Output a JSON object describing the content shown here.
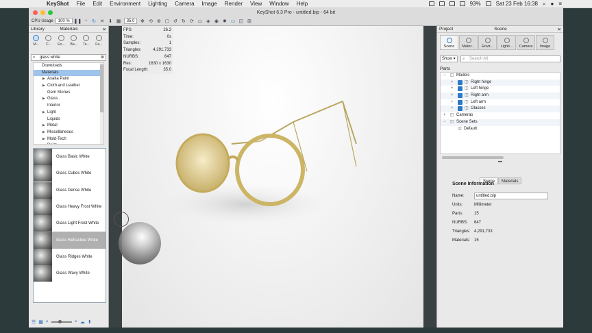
{
  "menubar": {
    "app": "KeyShot",
    "items": [
      "File",
      "Edit",
      "Environment",
      "Lighting",
      "Camera",
      "Image",
      "Render",
      "View",
      "Window",
      "Help"
    ],
    "battery": "93%",
    "clock": "Sat 23 Feb  16:38"
  },
  "window": {
    "title": "KeyShot 6.3 Pro  - untitled.bip  - 64 bit"
  },
  "toolbar": {
    "cpu_label": "CPU Usage",
    "cpu_value": "100 %",
    "focal_value": "35.0"
  },
  "library": {
    "header": "Library",
    "title": "Materials",
    "categories": [
      "M...",
      "C...",
      "En...",
      "Ba...",
      "Te...",
      "Fa..."
    ],
    "search_value": "glass white",
    "tree": [
      {
        "label": "Downloads",
        "level": 0,
        "style": "down"
      },
      {
        "label": "Materials",
        "level": 0,
        "style": "sel"
      },
      {
        "label": "Axalta Paint",
        "level": 1,
        "arrow": true
      },
      {
        "label": "Cloth and Leather",
        "level": 1,
        "arrow": true
      },
      {
        "label": "Gem Stones",
        "level": 1,
        "arrow": false
      },
      {
        "label": "Glass",
        "level": 1,
        "arrow": true
      },
      {
        "label": "Interior",
        "level": 1,
        "arrow": false
      },
      {
        "label": "Light",
        "level": 1,
        "arrow": true
      },
      {
        "label": "Liquids",
        "level": 1,
        "arrow": false
      },
      {
        "label": "Metal",
        "level": 1,
        "arrow": true
      },
      {
        "label": "Miscellaneous",
        "level": 1,
        "arrow": true
      },
      {
        "label": "Mold-Tech",
        "level": 1,
        "arrow": true
      },
      {
        "label": "Paint",
        "level": 1,
        "arrow": true
      }
    ],
    "thumbnails": [
      "Glass Basic White",
      "Glass Cubes White",
      "Glass Dense White",
      "Glass Heavy Frost White",
      "Glass Light Frost White",
      "Glass Refractive White",
      "Glass Ridges White",
      "Glass Wavy White"
    ],
    "selected_thumbnail": "Glass Refractive White"
  },
  "stats": [
    {
      "k": "FPS:",
      "v": "26.3"
    },
    {
      "k": "Time:",
      "v": "0s"
    },
    {
      "k": "Samples:",
      "v": "1"
    },
    {
      "k": "Triangles:",
      "v": "4,291,733"
    },
    {
      "k": "NURBS:",
      "v": "647"
    },
    {
      "k": "Res:",
      "v": "1630 x 1630"
    },
    {
      "k": "Focal Length:",
      "v": "35.0"
    }
  ],
  "project": {
    "header": "Project",
    "title": "Scene",
    "tabs": [
      "Scene",
      "Mater...",
      "Envir...",
      "Lighti...",
      "Camera",
      "Image"
    ],
    "show_label": "Show",
    "search_placeholder": "Search All",
    "parts_label": "Parts",
    "tree": [
      {
        "label": "Models",
        "level": 0,
        "pm": "-"
      },
      {
        "label": "Right hinge",
        "level": 1,
        "pm": "+",
        "checked": true
      },
      {
        "label": "Left hinge",
        "level": 1,
        "pm": "+",
        "checked": true
      },
      {
        "label": "Right arm",
        "level": 1,
        "pm": "+",
        "checked": true
      },
      {
        "label": "Left arm",
        "level": 1,
        "pm": "+",
        "checked": true
      },
      {
        "label": "Glasses",
        "level": 1,
        "pm": "+",
        "checked": true
      },
      {
        "label": "Cameras",
        "level": 0,
        "pm": "+"
      },
      {
        "label": "Scene Sets",
        "level": 0,
        "pm": "-"
      },
      {
        "label": "Default",
        "level": 1,
        "pm": ""
      }
    ],
    "subtabs": [
      "Scene",
      "Materials"
    ],
    "info": {
      "heading": "Scene Information",
      "name_label": "Name:",
      "name_value": "untitled.bip",
      "rows": [
        {
          "k": "Units:",
          "v": "Millimeter"
        },
        {
          "k": "Parts:",
          "v": "15"
        },
        {
          "k": "NURBS:",
          "v": "647"
        },
        {
          "k": "Triangles:",
          "v": "4,291,733"
        },
        {
          "k": "Materials:",
          "v": "15"
        }
      ]
    }
  }
}
